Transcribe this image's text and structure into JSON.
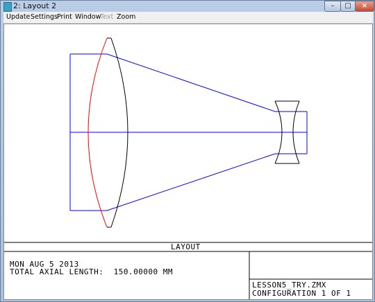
{
  "window": {
    "title": "2: Layout 2"
  },
  "menubar": {
    "items": [
      "Update",
      "Settings",
      "Print",
      "Window",
      "Text",
      "Zoom"
    ]
  },
  "layout": {
    "heading": "LAYOUT",
    "date": "MON AUG 5 2013",
    "axial_length": "TOTAL AXIAL LENGTH:  150.00000 MM",
    "file": "LESSON5_TRY.ZMX",
    "configuration": "CONFIGURATION 1 OF 1"
  },
  "colors": {
    "ray": "#0000ff",
    "surface_front": "#ff0000",
    "lens": "#000000"
  }
}
